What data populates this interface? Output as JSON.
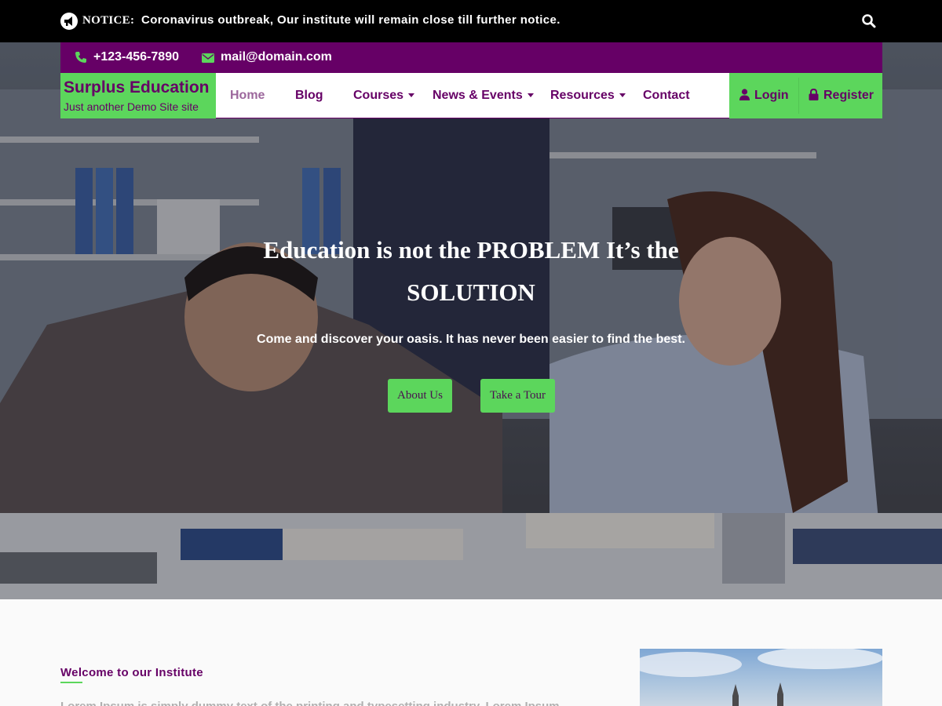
{
  "notice": {
    "label": "NOTICE:",
    "text": "Coronavirus outbreak, Our institute will remain close till further notice.",
    "icon": "megaphone-icon",
    "search_icon": "search-icon"
  },
  "contact": {
    "phone": "+123-456-7890",
    "email": "mail@domain.com"
  },
  "brand": {
    "name": "Surplus Education",
    "tagline": "Just another Demo Site site"
  },
  "nav": {
    "items": [
      {
        "label": "Home",
        "active": true
      },
      {
        "label": "Blog"
      },
      {
        "label": "Courses",
        "dropdown": true
      },
      {
        "label": "News & Events",
        "dropdown": true
      },
      {
        "label": "Resources",
        "dropdown": true
      },
      {
        "label": "Contact"
      }
    ]
  },
  "auth": {
    "login": "Login",
    "register": "Register"
  },
  "hero": {
    "title": "Education is not the PROBLEM It’s the SOLUTION",
    "subtitle": "Come and discover your oasis. It has never been easier to find the best.",
    "buttons": [
      "About Us",
      "Take a Tour"
    ]
  },
  "welcome": {
    "heading": "Welcome to our Institute",
    "text": "Lorem Ipsum is simply dummy text of the printing and typesetting industry. Lorem Ipsum"
  },
  "colors": {
    "brand_purple": "#660066",
    "accent_green": "#5cd65c",
    "notice_bg": "#000000"
  }
}
